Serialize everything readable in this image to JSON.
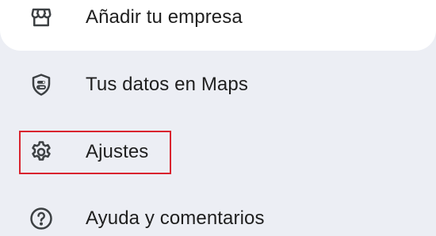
{
  "menu": {
    "items": [
      {
        "label": "Añadir tu empresa",
        "icon": "storefront-icon"
      },
      {
        "label": "Tus datos en Maps",
        "icon": "shield-toggle-icon"
      },
      {
        "label": "Ajustes",
        "icon": "gear-icon"
      },
      {
        "label": "Ayuda y comentarios",
        "icon": "help-circle-icon"
      }
    ]
  },
  "colors": {
    "background": "#eceef4",
    "card": "#ffffff",
    "text": "#1f1f1f",
    "icon": "#3c4043",
    "highlight": "#d9232e"
  }
}
